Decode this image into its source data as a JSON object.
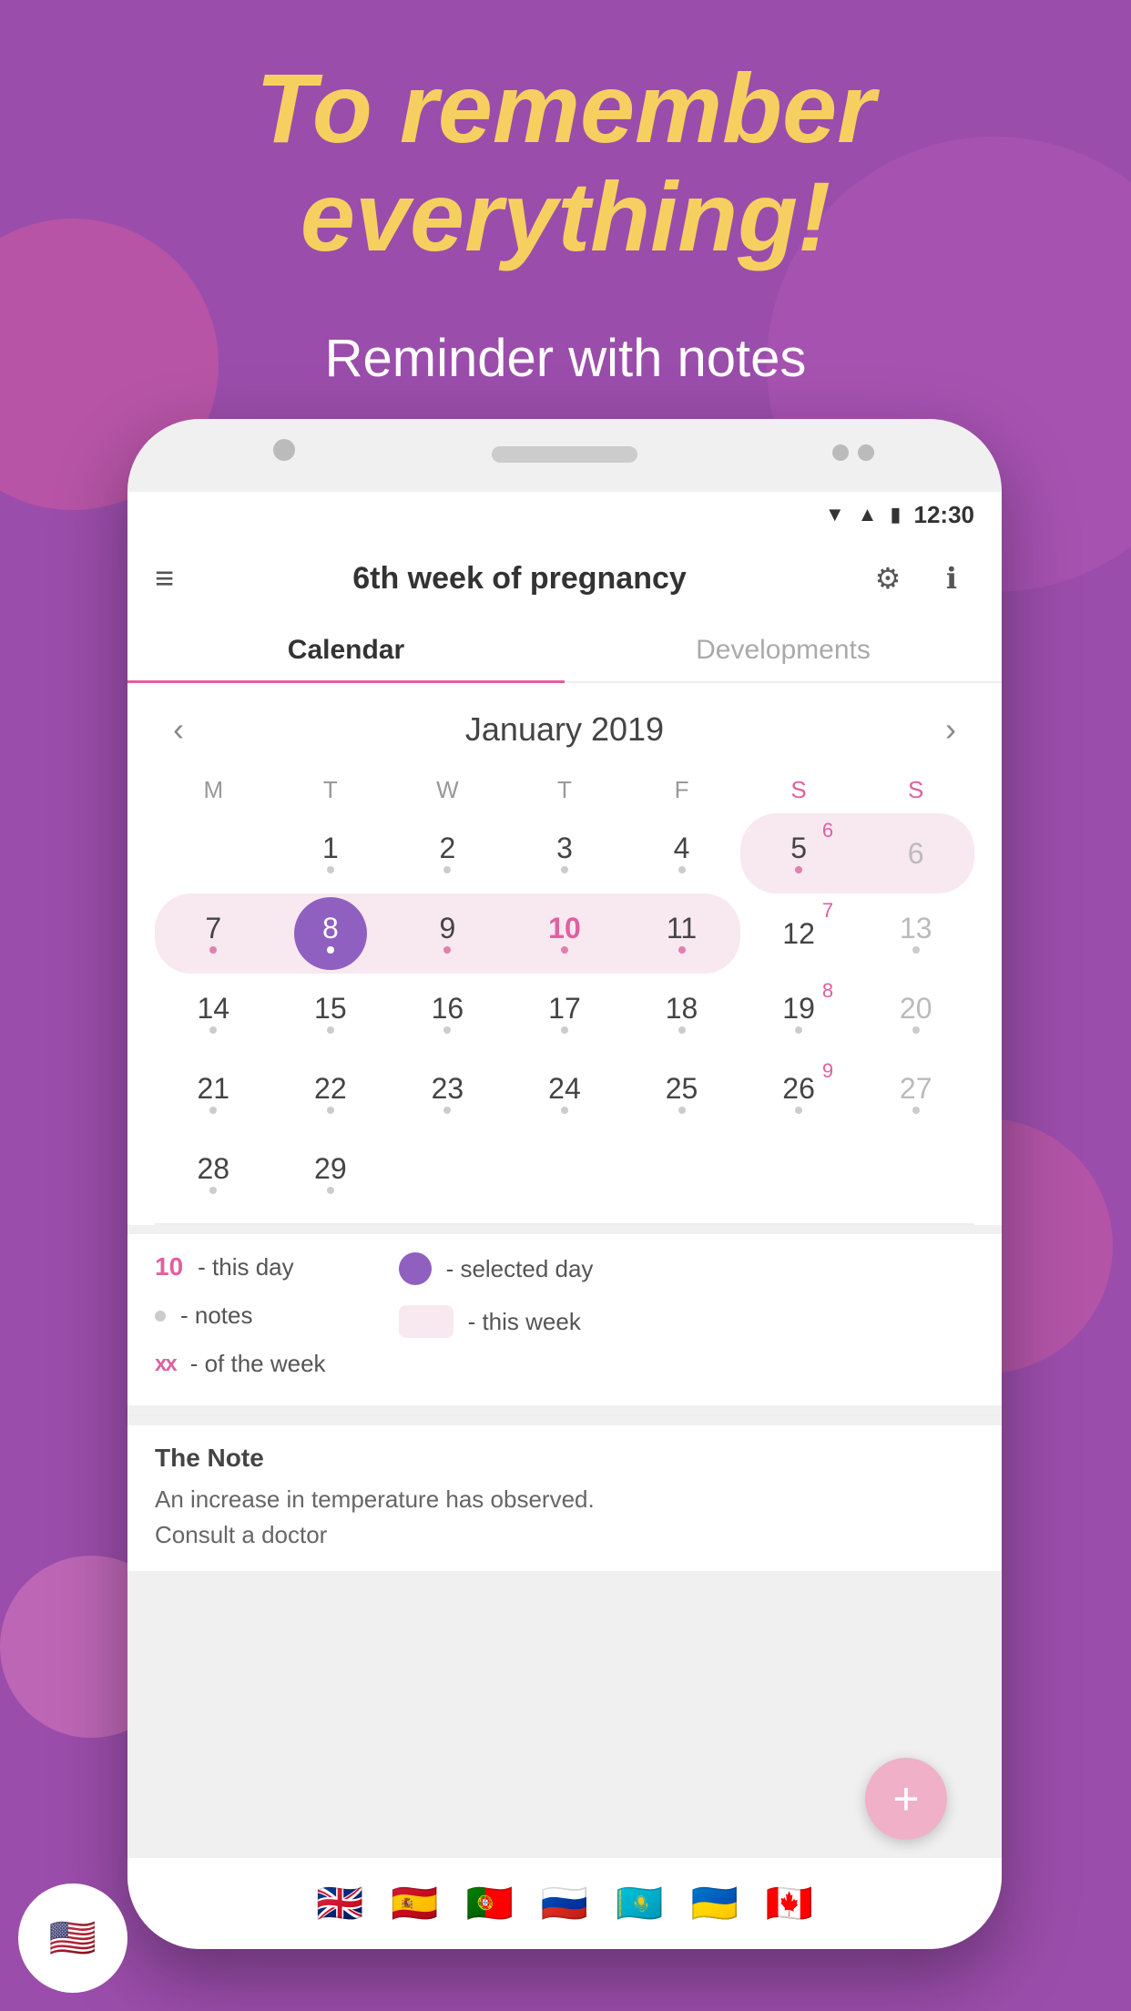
{
  "background": {
    "color": "#9b4dab"
  },
  "hero": {
    "title": "To remember everything!",
    "subtitle": "Reminder with notes"
  },
  "status_bar": {
    "time": "12:30",
    "icons": [
      "wifi",
      "signal",
      "battery"
    ]
  },
  "app_header": {
    "title": "6th week of pregnancy",
    "menu_icon": "≡",
    "settings_icon": "⚙",
    "info_icon": "ℹ"
  },
  "tabs": [
    {
      "label": "Calendar",
      "active": true
    },
    {
      "label": "Developments",
      "active": false
    }
  ],
  "calendar": {
    "month_year": "January 2019",
    "weekdays": [
      "M",
      "T",
      "W",
      "T",
      "F",
      "S",
      "S"
    ],
    "weeks": [
      [
        {
          "day": 0,
          "empty": true
        },
        {
          "day": 1,
          "dot": true,
          "pink_dot": false
        },
        {
          "day": 2,
          "dot": true
        },
        {
          "day": 3,
          "dot": true
        },
        {
          "day": 4,
          "dot": true
        },
        {
          "day": 5,
          "dot": true,
          "weekend": false,
          "this_week": true,
          "week_num": "6"
        },
        {
          "day": 6,
          "dot": false,
          "weekend": true,
          "this_week": true
        }
      ],
      [
        {
          "day": 7,
          "dot": true,
          "this_week": true
        },
        {
          "day": 8,
          "dot": true,
          "this_week": true,
          "selected": true
        },
        {
          "day": 9,
          "dot": true,
          "this_week": true
        },
        {
          "day": 10,
          "dot": true,
          "this_week": true,
          "today": true
        },
        {
          "day": 11,
          "dot": true,
          "this_week": true
        },
        {
          "day": 12,
          "dot": false,
          "this_week": false,
          "week_num": "7"
        },
        {
          "day": 13,
          "dot": true,
          "weekend": true
        }
      ],
      [
        {
          "day": 14,
          "dot": true
        },
        {
          "day": 15,
          "dot": true
        },
        {
          "day": 16,
          "dot": true
        },
        {
          "day": 17,
          "dot": true
        },
        {
          "day": 18,
          "dot": true
        },
        {
          "day": 19,
          "dot": true,
          "week_num": "8"
        },
        {
          "day": 20,
          "dot": true,
          "weekend": true
        }
      ],
      [
        {
          "day": 21,
          "dot": true
        },
        {
          "day": 22,
          "dot": true
        },
        {
          "day": 23,
          "dot": true
        },
        {
          "day": 24,
          "dot": true
        },
        {
          "day": 25,
          "dot": true
        },
        {
          "day": 26,
          "dot": true,
          "week_num": "9"
        },
        {
          "day": 27,
          "dot": true,
          "weekend": true
        }
      ],
      [
        {
          "day": 28,
          "dot": true
        },
        {
          "day": 29,
          "dot": true
        },
        {
          "day": 0,
          "empty": true
        },
        {
          "day": 0,
          "empty": true
        },
        {
          "day": 0,
          "empty": true
        },
        {
          "day": 0,
          "empty": true
        },
        {
          "day": 0,
          "empty": true
        }
      ]
    ]
  },
  "legend": {
    "items": [
      {
        "symbol": "10",
        "type": "num",
        "text": "- this day"
      },
      {
        "symbol": "dot",
        "type": "dot",
        "text": "- notes"
      },
      {
        "symbol": "xx",
        "type": "xx",
        "text": "- of the week"
      },
      {
        "symbol": "circle",
        "type": "circle",
        "text": "- selected day"
      },
      {
        "symbol": "week_box",
        "type": "weekbox",
        "text": "- this week"
      }
    ]
  },
  "note": {
    "title": "The Note",
    "text": "An increase in temperature has observed.\nConsult a doctor"
  },
  "fab": {
    "label": "+"
  },
  "flags": [
    "🇺🇸",
    "🇬🇧",
    "🇪🇸",
    "🇵🇹",
    "🇷🇺",
    "🇰🇿",
    "🇺🇦",
    "🇨🇦"
  ],
  "corner_flag": "🇺🇸"
}
